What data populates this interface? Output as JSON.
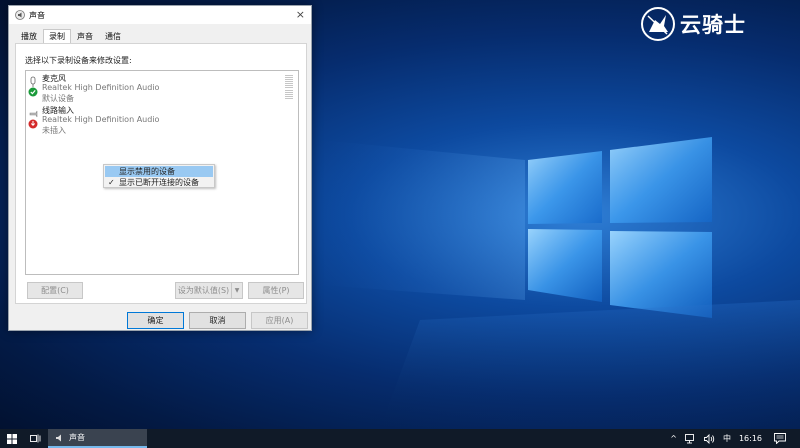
{
  "watermark": {
    "text": "云骑士"
  },
  "dialog": {
    "title": "声音",
    "close_glyph": "×",
    "tabs": [
      "播放",
      "录制",
      "声音",
      "通信"
    ],
    "active_tab": 1,
    "instruction": "选择以下录制设备来修改设置:",
    "devices": [
      {
        "name": "麦克风",
        "driver": "Realtek High Definition Audio",
        "status": "默认设备",
        "icon": "microphone-icon",
        "badge": "check-badge",
        "badge_color": "#1a9a3a"
      },
      {
        "name": "线路输入",
        "driver": "Realtek High Definition Audio",
        "status": "未插入",
        "icon": "line-in-icon",
        "badge": "unplugged-badge",
        "badge_color": "#d42a2a"
      }
    ],
    "context_menu": {
      "items": [
        {
          "label": "显示禁用的设备",
          "checked": false,
          "hovered": true
        },
        {
          "label": "显示已断开连接的设备",
          "checked": true,
          "hovered": false
        }
      ],
      "check_glyph": "✓"
    },
    "buttons": {
      "configure": "配置(C)",
      "set_default": "设为默认值(S)",
      "set_default_arrow": "▼",
      "properties": "属性(P)",
      "ok": "确定",
      "cancel": "取消",
      "apply": "应用(A)"
    }
  },
  "taskbar": {
    "app_label": "声音",
    "tray_chevron": "^",
    "ime": "中",
    "time": "16:16"
  },
  "colors": {
    "accent": "#0078d7",
    "menu_hover": "#99c9f2",
    "taskbar": "#101a28"
  }
}
